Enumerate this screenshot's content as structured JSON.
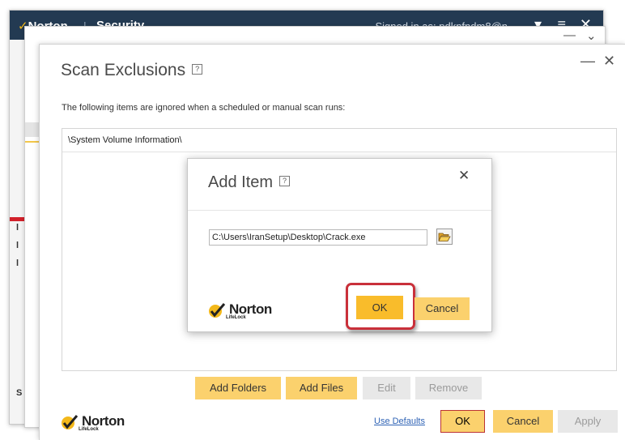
{
  "background_window": {
    "brand": "Norton",
    "separator": "|",
    "section": "Security",
    "signed_in": "Signed in as: pdknfndm8@n",
    "left_letters": [
      "l",
      "l",
      "l",
      "S"
    ]
  },
  "dialog": {
    "title": "Scan Exclusions",
    "help": "?",
    "minimize": "—",
    "close": "✕",
    "description": "The following items are ignored when a scheduled or manual scan runs:",
    "items": [
      "\\System Volume Information\\"
    ],
    "buttons": {
      "add_folders": "Add Folders",
      "add_files": "Add Files",
      "edit": "Edit",
      "remove": "Remove"
    },
    "footer": {
      "use_defaults": "Use Defaults",
      "ok": "OK",
      "cancel": "Cancel",
      "apply": "Apply"
    }
  },
  "add_item": {
    "title": "Add Item",
    "help": "?",
    "close": "✕",
    "path_value": "C:\\Users\\IranSetup\\Desktop\\Crack.exe",
    "ok": "OK",
    "cancel": "Cancel"
  },
  "logo": {
    "word": "Norton",
    "sub": "LifeLock"
  },
  "colors": {
    "accent_yellow": "#fbd16d",
    "ok_yellow": "#f9bc2b",
    "highlight_red": "#c9303a",
    "titlebar": "#233a52",
    "check": "#f3b81a"
  }
}
